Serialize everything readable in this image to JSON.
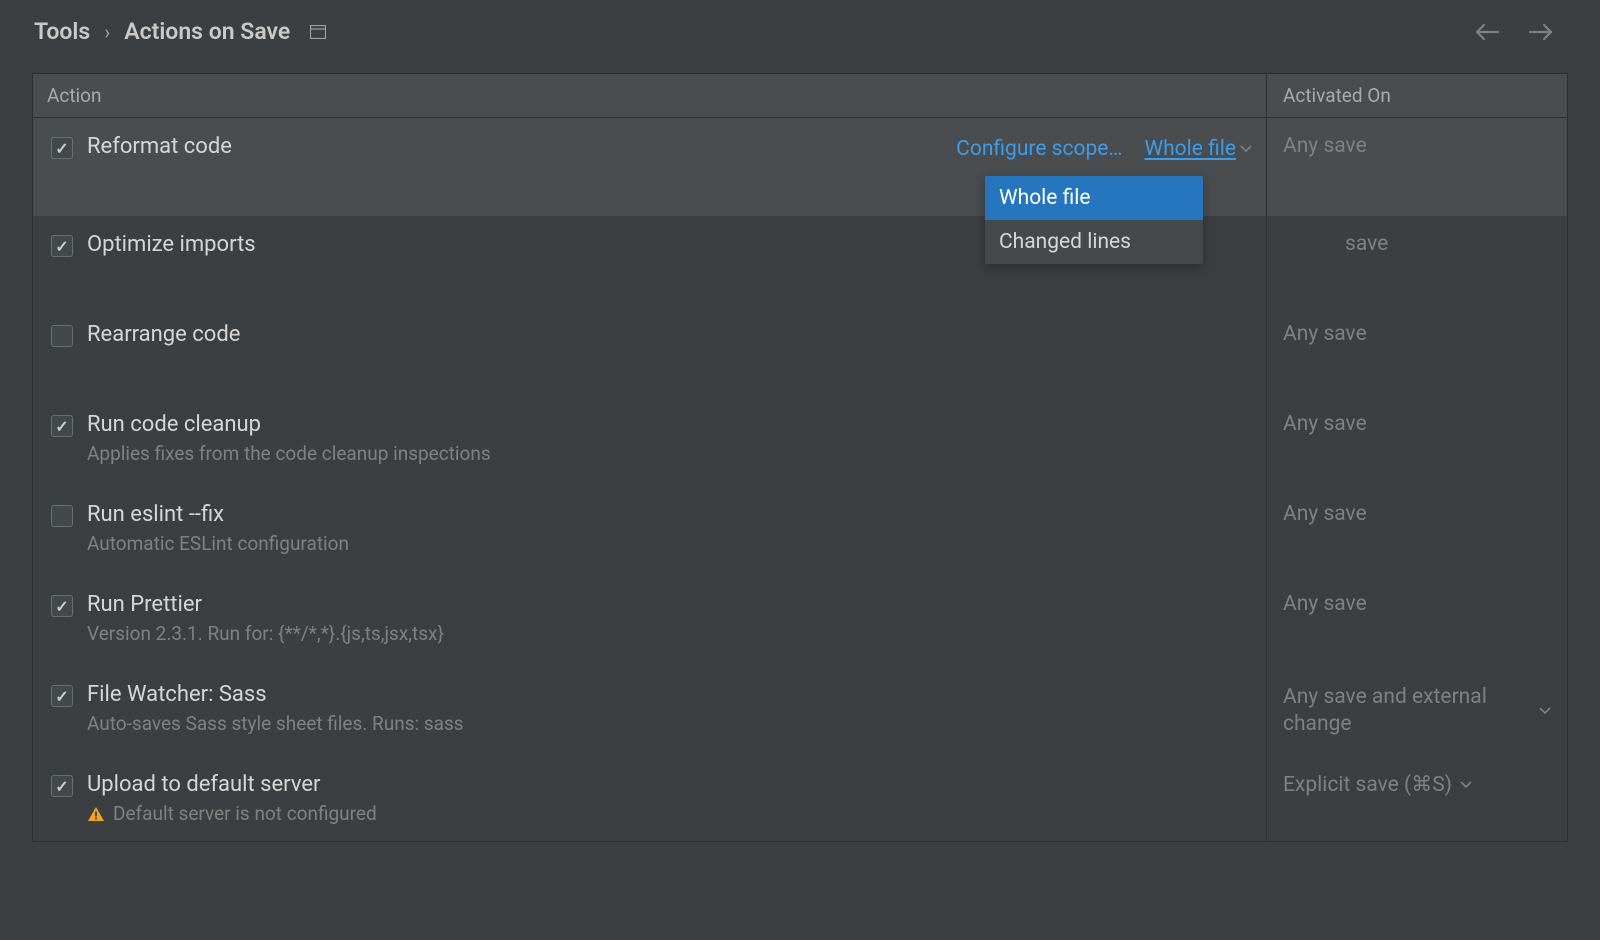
{
  "breadcrumb": {
    "parent": "Tools",
    "current": "Actions on Save"
  },
  "columns": {
    "action": "Action",
    "activated": "Activated On"
  },
  "rows": {
    "reformat": {
      "label": "Reformat code",
      "activated": "Any save",
      "configure": "Configure scope…",
      "scope_selected": "Whole file"
    },
    "optimize": {
      "label": "Optimize imports",
      "activated": "save"
    },
    "rearrange": {
      "label": "Rearrange code",
      "activated": "Any save"
    },
    "cleanup": {
      "label": "Run code cleanup",
      "desc": "Applies fixes from the code cleanup inspections",
      "activated": "Any save"
    },
    "eslint": {
      "label": "Run eslint --fix",
      "desc": "Automatic ESLint configuration",
      "activated": "Any save"
    },
    "prettier": {
      "label": "Run Prettier",
      "desc": "Version 2.3.1. Run for: {**/*,*}.{js,ts,jsx,tsx}",
      "activated": "Any save"
    },
    "sass": {
      "label": "File Watcher: Sass",
      "desc": "Auto-saves Sass style sheet files. Runs: sass",
      "activated": "Any save and external change"
    },
    "upload": {
      "label": "Upload to default server",
      "desc": "Default server is not configured",
      "activated": "Explicit save (⌘S)"
    }
  },
  "dropdown": {
    "options": [
      "Whole file",
      "Changed lines"
    ]
  }
}
